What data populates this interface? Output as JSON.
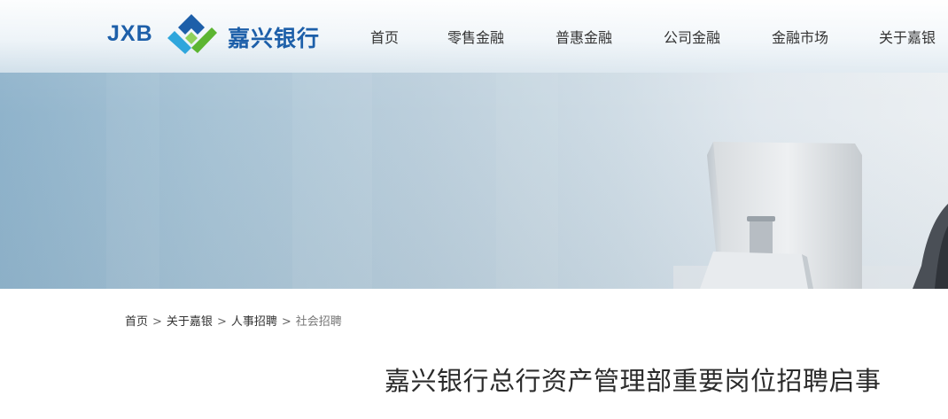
{
  "brand": {
    "logo_en": "JXB",
    "logo_cn": "嘉兴银行",
    "color_primary": "#1d5fa9",
    "color_accent_green": "#5cb531",
    "color_accent_cyan": "#2fa6dc"
  },
  "nav": {
    "items": [
      {
        "label": "首页"
      },
      {
        "label": "零售金融"
      },
      {
        "label": "普惠金融"
      },
      {
        "label": "公司金融"
      },
      {
        "label": "金融市场"
      },
      {
        "label": "关于嘉银"
      }
    ]
  },
  "breadcrumb": {
    "items": [
      "首页",
      "关于嘉银",
      "人事招聘",
      "社会招聘"
    ],
    "separator": ">"
  },
  "article": {
    "title": "嘉兴银行总行资产管理部重要岗位招聘启事"
  }
}
